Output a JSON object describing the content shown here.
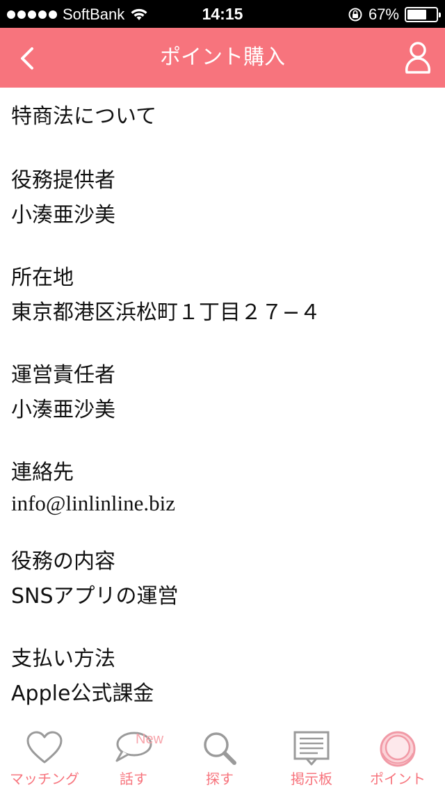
{
  "status_bar": {
    "carrier": "SoftBank",
    "time": "14:15",
    "battery": "67%",
    "battery_level": 0.67
  },
  "nav": {
    "title": "ポイント購入"
  },
  "content": {
    "heading": "特商法について",
    "sections": [
      {
        "label": "役務提供者",
        "value": "小湊亜沙美"
      },
      {
        "label": "所在地",
        "value": "東京都港区浜松町１丁目２７−４"
      },
      {
        "label": "運営責任者",
        "value": "小湊亜沙美"
      },
      {
        "label": "連絡先",
        "value": "info@linlinline.biz"
      },
      {
        "label": "役務の内容",
        "value": "SNSアプリの運営"
      },
      {
        "label": "支払い方法",
        "value": "Apple公式課金"
      }
    ]
  },
  "tabs": [
    {
      "label": "マッチング",
      "icon": "heart-icon"
    },
    {
      "label": "話す",
      "icon": "speech-bubble-icon",
      "badge": "New"
    },
    {
      "label": "探す",
      "icon": "search-icon"
    },
    {
      "label": "掲示板",
      "icon": "board-icon"
    },
    {
      "label": "ポイント",
      "icon": "coin-icon"
    }
  ],
  "colors": {
    "accent": "#f7747d",
    "tab_inactive_icon": "#9a9a9a"
  }
}
